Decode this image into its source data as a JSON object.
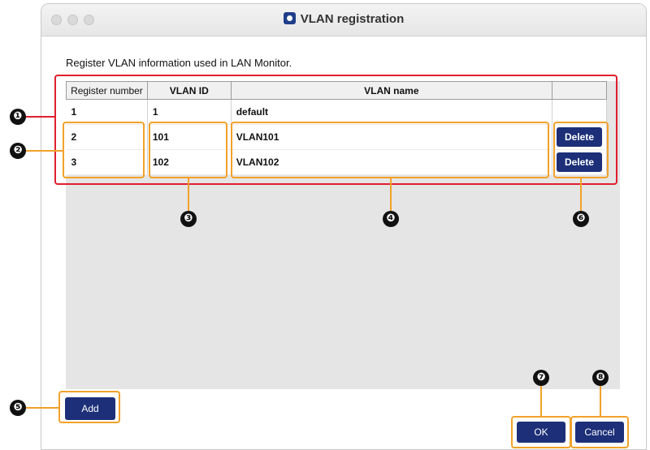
{
  "window": {
    "title": "VLAN registration"
  },
  "description": "Register VLAN information used in LAN Monitor.",
  "table": {
    "headers": [
      "Register number",
      "VLAN ID",
      "VLAN name",
      ""
    ],
    "rows": [
      {
        "register_number": "1",
        "vlan_id": "1",
        "vlan_name": "default",
        "action": ""
      },
      {
        "register_number": "2",
        "vlan_id": "101",
        "vlan_name": "VLAN101",
        "action": "Delete"
      },
      {
        "register_number": "3",
        "vlan_id": "102",
        "vlan_name": "VLAN102",
        "action": "Delete"
      }
    ]
  },
  "buttons": {
    "add": "Add",
    "ok": "OK",
    "cancel": "Cancel"
  },
  "callouts": [
    "❶",
    "❷",
    "❸",
    "❹",
    "❺",
    "❻",
    "❼",
    "❽"
  ],
  "colors": {
    "button_bg": "#1c2f78",
    "highlight_red": "#e01e2e",
    "highlight_orange": "#f2a12a"
  }
}
